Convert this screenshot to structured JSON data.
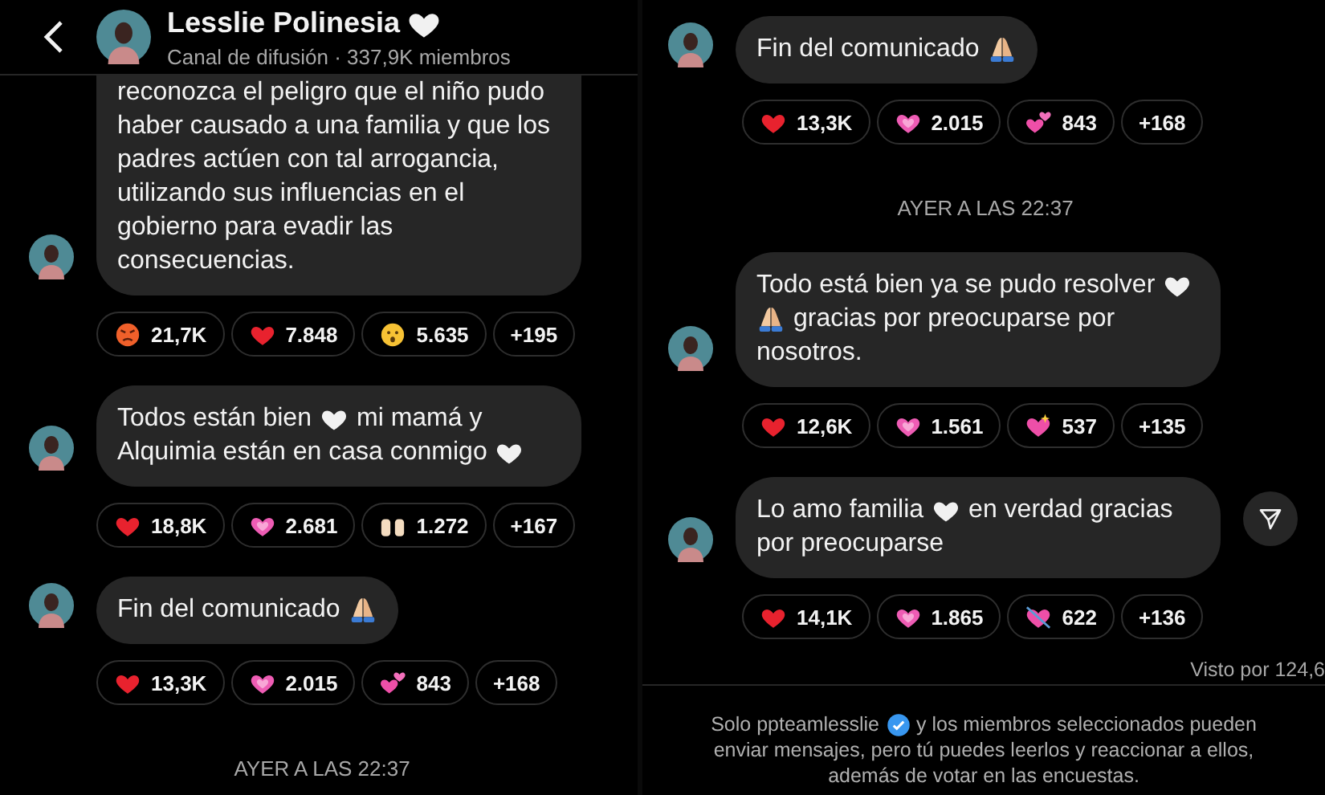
{
  "panels": [
    {
      "header": {
        "title": "Lesslie Polinesia",
        "badge": {
          "kind": "white-heart"
        },
        "subtitle": "Canal de difusión · 337,9K miembros"
      },
      "items": [
        {
          "kind": "message",
          "cut_top": true,
          "parts": [
            {
              "kind": "text",
              "text": "reconozca el peligro que el niño pudo haber causado a una familia y que los padres actúen con tal arrogancia, utilizando sus influencias en el gobierno para evadir las consecuencias."
            }
          ],
          "reactions": [
            {
              "kind": "angry",
              "count": "21,7K"
            },
            {
              "kind": "red-heart",
              "count": "7.848"
            },
            {
              "kind": "surprised",
              "count": "5.635"
            },
            {
              "kind": "more",
              "count": "+195"
            }
          ]
        },
        {
          "kind": "message",
          "parts": [
            {
              "kind": "text",
              "text": "Todos están bien"
            },
            {
              "kind": "white-heart"
            },
            {
              "kind": "text",
              "text": "mi mamá y"
            },
            {
              "kind": "text",
              "text": "Alquimia están en casa conmigo"
            },
            {
              "kind": "white-heart"
            }
          ],
          "reactions": [
            {
              "kind": "red-heart",
              "count": "18,8K"
            },
            {
              "kind": "pink-heart",
              "count": "2.681"
            },
            {
              "kind": "raised-hands",
              "count": "1.272"
            },
            {
              "kind": "more",
              "count": "+167"
            }
          ]
        },
        {
          "kind": "message",
          "parts": [
            {
              "kind": "text",
              "text": "Fin del comunicado"
            },
            {
              "kind": "pray"
            }
          ],
          "reactions": [
            {
              "kind": "red-heart",
              "count": "13,3K"
            },
            {
              "kind": "pink-heart",
              "count": "2.015"
            },
            {
              "kind": "two-hearts",
              "count": "843"
            },
            {
              "kind": "more",
              "count": "+168"
            }
          ]
        },
        {
          "kind": "timestamp",
          "text": "AYER A LAS 22:37"
        }
      ]
    },
    {
      "items": [
        {
          "kind": "message",
          "parts": [
            {
              "kind": "text",
              "text": "Fin del comunicado"
            },
            {
              "kind": "pray"
            }
          ],
          "reactions": [
            {
              "kind": "red-heart",
              "count": "13,3K"
            },
            {
              "kind": "pink-heart",
              "count": "2.015"
            },
            {
              "kind": "two-hearts",
              "count": "843"
            },
            {
              "kind": "more",
              "count": "+168"
            }
          ]
        },
        {
          "kind": "timestamp",
          "text": "AYER A LAS 22:37"
        },
        {
          "kind": "message",
          "parts": [
            {
              "kind": "text",
              "text": "Todo está bien ya se pudo resolver"
            },
            {
              "kind": "white-heart"
            },
            {
              "kind": "pray"
            },
            {
              "kind": "text",
              "text": "gracias por preocuparse por"
            },
            {
              "kind": "text",
              "text": "nosotros."
            }
          ],
          "reactions": [
            {
              "kind": "red-heart",
              "count": "12,6K"
            },
            {
              "kind": "pink-heart",
              "count": "1.561"
            },
            {
              "kind": "sparkling-heart",
              "count": "537"
            },
            {
              "kind": "more",
              "count": "+135"
            }
          ]
        },
        {
          "kind": "message",
          "share_button": true,
          "parts": [
            {
              "kind": "text",
              "text": "Lo amo familia"
            },
            {
              "kind": "white-heart"
            },
            {
              "kind": "text",
              "text": "en verdad gracias"
            },
            {
              "kind": "text",
              "text": "por preocuparse"
            }
          ],
          "reactions": [
            {
              "kind": "red-heart",
              "count": "14,1K"
            },
            {
              "kind": "pink-heart",
              "count": "1.865"
            },
            {
              "kind": "heart-arrow",
              "count": "622"
            },
            {
              "kind": "more",
              "count": "+136"
            }
          ]
        },
        {
          "kind": "seen",
          "text": "Visto por 124,6"
        }
      ],
      "footer": {
        "parts": [
          {
            "kind": "text",
            "text": "Solo ppteamlesslie"
          },
          {
            "kind": "verified"
          },
          {
            "kind": "text",
            "text": "y los miembros seleccionados pueden"
          },
          {
            "kind": "text",
            "text": "enviar mensajes, pero tú puedes leerlos y reaccionar a ellos,"
          },
          {
            "kind": "text",
            "text": "además de votar en las encuestas."
          }
        ]
      }
    }
  ]
}
